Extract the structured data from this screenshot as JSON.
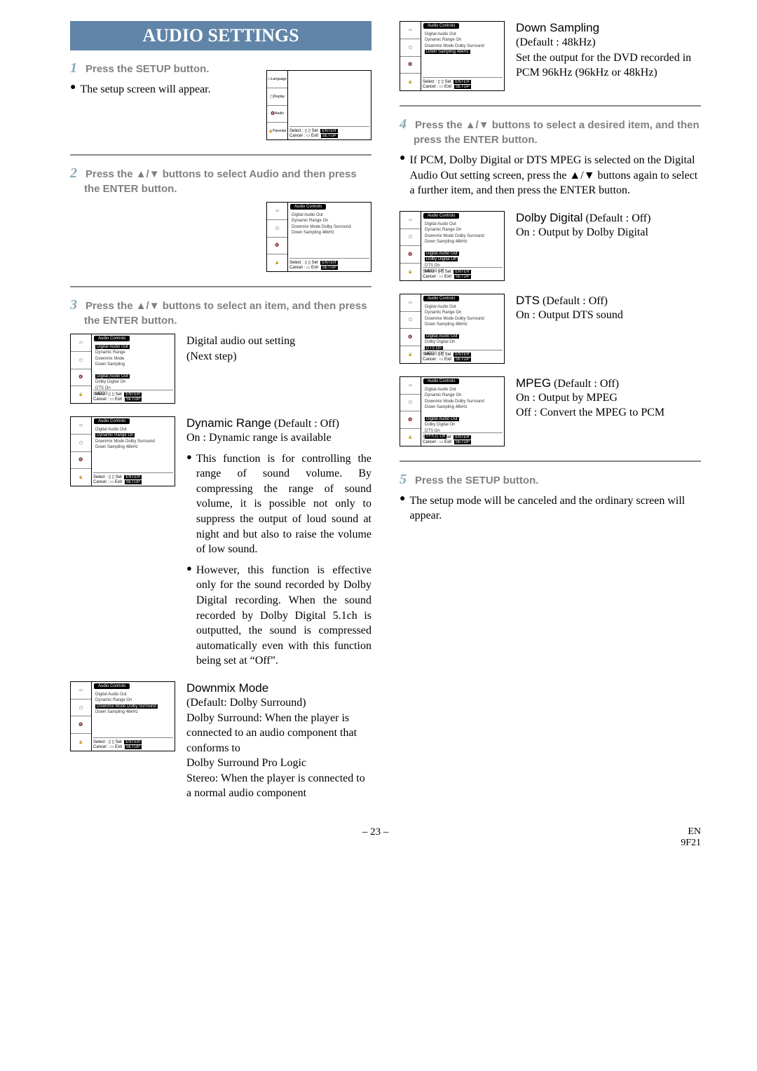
{
  "title": "AUDIO SETTINGS",
  "step1": {
    "num": "1",
    "text": "Press the SETUP button."
  },
  "bullet1": "The setup screen will appear.",
  "step2": {
    "num": "2",
    "text": "Press the ▲/▼ buttons to select Audio and then press the ENTER button."
  },
  "step3": {
    "num": "3",
    "text": "Press the ▲/▼ buttons to select an item, and then press the ENTER button."
  },
  "digitalOut": {
    "title": "Digital audio out setting",
    "note": "(Next step)"
  },
  "dynamicRange": {
    "title": "Dynamic Range",
    "default": " (Default : Off)",
    "sub": "On : Dynamic range is available",
    "b1": "This function is for controlling the range of sound volume. By compressing the range of sound volume, it is possible not only to suppress the output of loud sound at night and but also to raise the volume of low sound.",
    "b2": "However, this function is effective only for the sound recorded by Dolby Digital recording. When the sound recorded by Dolby Digital 5.1ch is outputted, the sound is compressed automatically even with this function being set at “Off”."
  },
  "downmix": {
    "title": "Downmix Mode",
    "body": "(Default: Dolby Surround)\nDolby Surround: When the player is connected to an audio component that conforms to\nDolby Surround Pro Logic\nStereo: When the player is connected to a normal audio component"
  },
  "downSampling": {
    "title": "Down Sampling",
    "default": "(Default : 48kHz)",
    "body": "Set the output for the DVD recorded in PCM 96kHz (96kHz or 48kHz)"
  },
  "step4": {
    "num": "4",
    "text": "Press the ▲/▼ buttons to select a desired item, and then press the ENTER button."
  },
  "bullet4": "If PCM, Dolby Digital or DTS MPEG is selected on the Digital Audio Out setting screen, press the ▲/▼ buttons again to select a further item, and then press the ENTER button.",
  "dolby": {
    "title": "Dolby Digital",
    "default": " (Default : Off)",
    "sub": "On : Output by Dolby Digital"
  },
  "dts": {
    "title": "DTS",
    "default": " (Default : Off)",
    "sub": "On : Output DTS sound"
  },
  "mpeg": {
    "title": "MPEG",
    "default": " (Default : Off)",
    "sub1": "On : Output by MPEG",
    "sub2": "Off : Convert the MPEG to PCM"
  },
  "step5": {
    "num": "5",
    "text": "Press the SETUP button."
  },
  "bullet5": "The setup mode will be canceled and the ordinary screen will appear.",
  "thumb": {
    "header": "Audio Controls",
    "lines": "Digital Audio Out\nDynamic Range On\nDownmix Mode Dolby Surround\nDown Sampling 48kHz",
    "footer_left": "Select :",
    "footer_left2": "Cancel :",
    "tag_set": "Set",
    "tag_enter": "ENTER",
    "tag_exit": "Exit",
    "tag_setup": "SETUP",
    "sublist": "Digital Audio Out\nDolby Digital Off\nDTS On\nMPEG Off",
    "sublist2": "Digital Audio Out\nDolby Digital On\nDTS On\nMPEG Off"
  },
  "sidebar": {
    "s1": "Language",
    "s2": "Display",
    "s3": "Audio",
    "s4": "Parental"
  },
  "footer": {
    "center": "– 23 –",
    "right1": "EN",
    "right2": "9F21"
  }
}
